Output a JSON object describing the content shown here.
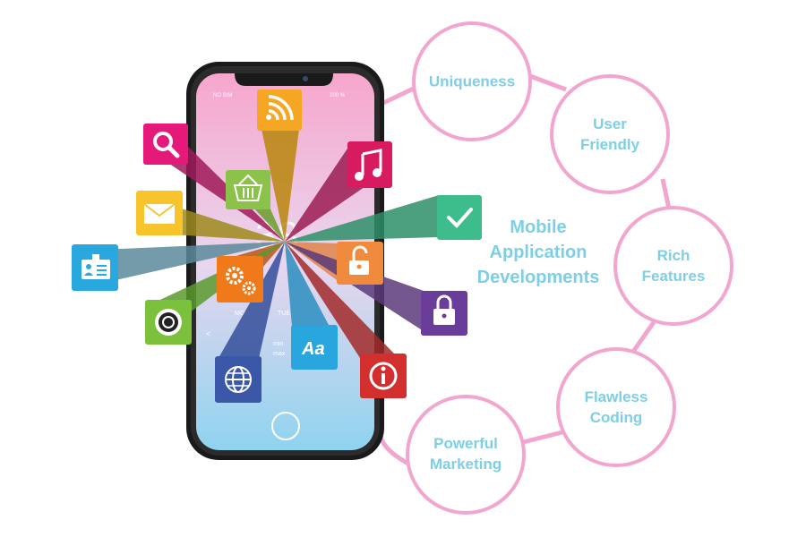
{
  "center_title": {
    "line1": "Mobile",
    "line2": "Application",
    "line3": "Developments"
  },
  "circles": [
    {
      "id": "uniqueness",
      "lines": [
        "Uniqueness"
      ]
    },
    {
      "id": "user-friendly",
      "lines": [
        "User",
        "Friendly"
      ]
    },
    {
      "id": "rich-features",
      "lines": [
        "Rich",
        "Features"
      ]
    },
    {
      "id": "flawless-coding",
      "lines": [
        "Flawless",
        "Coding"
      ]
    },
    {
      "id": "powerful-marketing",
      "lines": [
        "Powerful",
        "Marketing"
      ]
    }
  ],
  "phone": {
    "status_left": "NO SIM",
    "status_right": "100 %",
    "clock": "38",
    "day_labels": [
      "MON",
      "TUE"
    ],
    "min_label": "min",
    "max_label": "max",
    "back_glyph": "<"
  },
  "icons": [
    {
      "name": "wifi-icon",
      "color": "#f5a623"
    },
    {
      "name": "search-icon",
      "color": "#e5197a"
    },
    {
      "name": "music-icon",
      "color": "#d81b60"
    },
    {
      "name": "basket-icon",
      "color": "#8bc34a"
    },
    {
      "name": "mail-icon",
      "color": "#f7c52b"
    },
    {
      "name": "check-icon",
      "color": "#3dbd8c"
    },
    {
      "name": "id-card-icon",
      "color": "#29a8df"
    },
    {
      "name": "unlock-icon",
      "color": "#f08a3c"
    },
    {
      "name": "settings-icon",
      "color": "#f07a1a"
    },
    {
      "name": "lock-icon",
      "color": "#6a3d9a"
    },
    {
      "name": "record-icon",
      "color": "#7cc13c"
    },
    {
      "name": "font-icon",
      "color": "#2aa6df",
      "text": "Aa"
    },
    {
      "name": "globe-icon",
      "color": "#3b58a8"
    },
    {
      "name": "info-icon",
      "color": "#d32f2f"
    }
  ],
  "colors": {
    "circle_stroke": "#f2a6cf",
    "label": "#7ecfe6",
    "screen_top": "#f7a6cc",
    "screen_bottom": "#8fd3ef"
  }
}
